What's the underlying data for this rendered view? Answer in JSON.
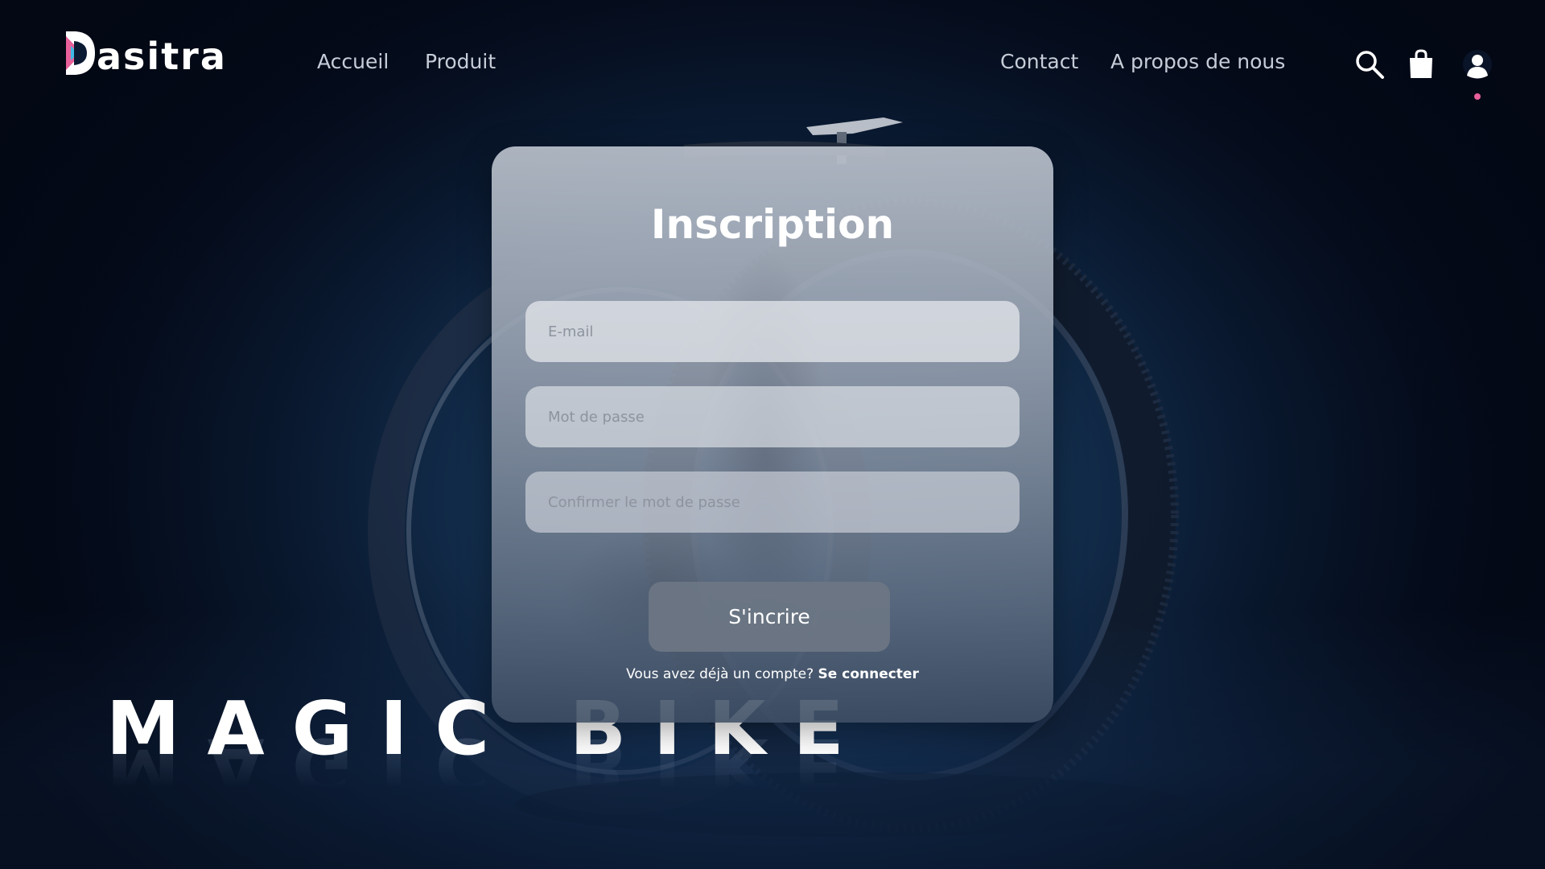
{
  "brand": {
    "name": "asitra",
    "accent_pink": "#e8609a",
    "accent_cyan": "#3fb9e6"
  },
  "nav": {
    "left": [
      "Accueil",
      "Produit"
    ],
    "right": [
      "Contact",
      "A propos de nous"
    ]
  },
  "icons": {
    "search": "search-icon",
    "cart": "shopping-bag-icon",
    "account": "user-icon"
  },
  "hero": {
    "headline": "MAGIC BIKE"
  },
  "form": {
    "title": "Inscription",
    "email_placeholder": "E-mail",
    "password_placeholder": "Mot de passe",
    "confirm_placeholder": "Confirmer le mot de passe",
    "submit_label": "S'incrire",
    "login_prompt": "Vous avez déjà un compte?",
    "login_link": "Se connecter"
  }
}
